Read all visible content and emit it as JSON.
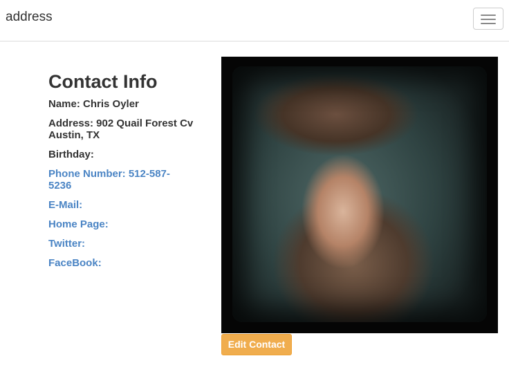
{
  "navbar": {
    "brand": "address",
    "toggle_icon": "hamburger-menu-icon"
  },
  "contact": {
    "heading": "Contact Info",
    "name": "Name: Chris Oyler",
    "address_line1": "Address: 902 Quail Forest Cv",
    "address_line2": "Austin, TX",
    "birthday": "Birthday:",
    "phone_line1": "Phone Number: 512-587-",
    "phone_line2": "5236",
    "email": "E-Mail:",
    "homepage": "Home Page:",
    "twitter": "Twitter:",
    "facebook": "FaceBook:"
  },
  "actions": {
    "edit_label": "Edit Contact"
  },
  "colors": {
    "link": "#4a84c4",
    "button": "#f0ad4e",
    "text": "#333333"
  }
}
